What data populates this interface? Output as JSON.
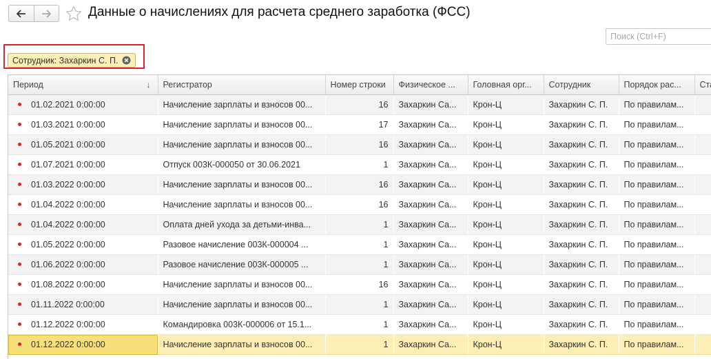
{
  "window": {
    "title": "Данные о начислениях для расчета среднего заработка (ФСС)"
  },
  "search": {
    "placeholder": "Поиск (Ctrl+F)"
  },
  "filter": {
    "label": "Сотрудник: Захаркин С. П."
  },
  "table": {
    "columns": [
      "Период",
      "Регистратор",
      "Номер строки",
      "Физическое ...",
      "Головная орг...",
      "Сотрудник",
      "Порядок рас...",
      "Ста"
    ],
    "rows": [
      {
        "period": "01.02.2021 0:00:00",
        "registrar": "Начисление зарплаты и взносов 00...",
        "line": "16",
        "person": "Захаркин Са...",
        "org": "Крон-Ц",
        "employee": "Захаркин С. П.",
        "order": "По правилам..."
      },
      {
        "period": "01.03.2021 0:00:00",
        "registrar": "Начисление зарплаты и взносов 00...",
        "line": "17",
        "person": "Захаркин Са...",
        "org": "Крон-Ц",
        "employee": "Захаркин С. П.",
        "order": "По правилам..."
      },
      {
        "period": "01.05.2021 0:00:00",
        "registrar": "Начисление зарплаты и взносов 00...",
        "line": "16",
        "person": "Захаркин Са...",
        "org": "Крон-Ц",
        "employee": "Захаркин С. П.",
        "order": "По правилам..."
      },
      {
        "period": "01.07.2021 0:00:00",
        "registrar": "Отпуск 003К-000050 от 30.06.2021",
        "line": "1",
        "person": "Захаркин Са...",
        "org": "Крон-Ц",
        "employee": "Захаркин С. П.",
        "order": "По правилам..."
      },
      {
        "period": "01.03.2022 0:00:00",
        "registrar": "Начисление зарплаты и взносов 00...",
        "line": "16",
        "person": "Захаркин Са...",
        "org": "Крон-Ц",
        "employee": "Захаркин С. П.",
        "order": "По правилам..."
      },
      {
        "period": "01.04.2022 0:00:00",
        "registrar": "Начисление зарплаты и взносов 00...",
        "line": "16",
        "person": "Захаркин Са...",
        "org": "Крон-Ц",
        "employee": "Захаркин С. П.",
        "order": "По правилам..."
      },
      {
        "period": "01.04.2022 0:00:00",
        "registrar": "Оплата дней ухода за детьми-инва...",
        "line": "1",
        "person": "Захаркин Са...",
        "org": "Крон-Ц",
        "employee": "Захаркин С. П.",
        "order": "По правилам..."
      },
      {
        "period": "01.05.2022 0:00:00",
        "registrar": "Разовое начисление 003К-000004 ...",
        "line": "1",
        "person": "Захаркин Са...",
        "org": "Крон-Ц",
        "employee": "Захаркин С. П.",
        "order": "По правилам..."
      },
      {
        "period": "01.06.2022 0:00:00",
        "registrar": "Разовое начисление 003К-000005 ...",
        "line": "1",
        "person": "Захаркин Са...",
        "org": "Крон-Ц",
        "employee": "Захаркин С. П.",
        "order": "По правилам..."
      },
      {
        "period": "01.08.2022 0:00:00",
        "registrar": "Начисление зарплаты и взносов 00...",
        "line": "16",
        "person": "Захаркин Са...",
        "org": "Крон-Ц",
        "employee": "Захаркин С. П.",
        "order": "По правилам..."
      },
      {
        "period": "01.11.2022 0:00:00",
        "registrar": "Начисление зарплаты и взносов 00...",
        "line": "1",
        "person": "Захаркин Са...",
        "org": "Крон-Ц",
        "employee": "Захаркин С. П.",
        "order": "По правилам..."
      },
      {
        "period": "01.12.2022 0:00:00",
        "registrar": "Командировка 003К-000006 от 15.1...",
        "line": "1",
        "person": "Захаркин Са...",
        "org": "Крон-Ц",
        "employee": "Захаркин С. П.",
        "order": "По правилам..."
      },
      {
        "period": "01.12.2022 0:00:00",
        "registrar": "Начисление зарплаты и взносов 00...",
        "line": "1",
        "person": "Захаркин Са...",
        "org": "Крон-Ц",
        "employee": "Захаркин С. П.",
        "order": "По правилам..."
      }
    ]
  },
  "colors": {
    "filter_highlight": "#e0242b",
    "selected_row": "#fbefb6",
    "row_marker": "#d8232a"
  },
  "icons": {
    "back": "arrow-left-icon",
    "forward": "arrow-right-icon",
    "favorite": "star-icon",
    "remove_filter": "close-circle-icon",
    "sort": "arrow-down-icon",
    "row_marker": "dot-icon"
  }
}
